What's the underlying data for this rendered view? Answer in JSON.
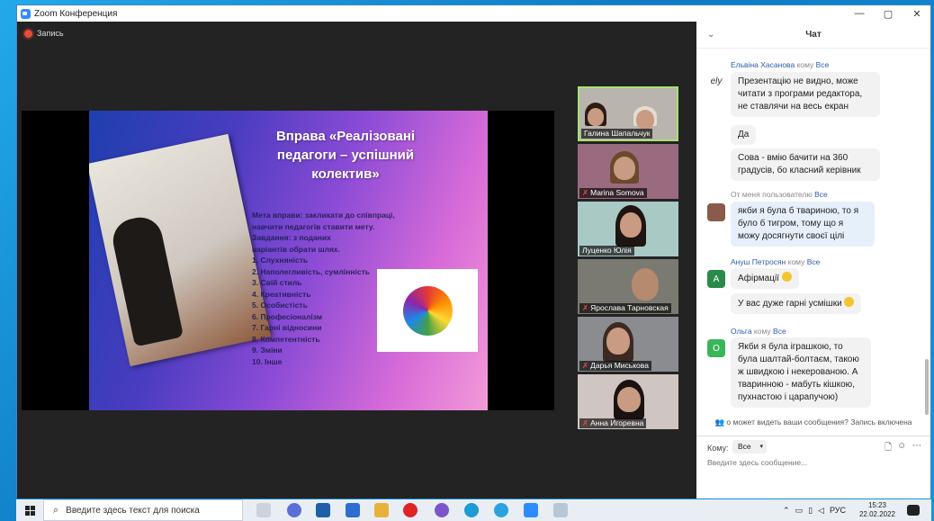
{
  "window": {
    "title": "Zoom Конференция"
  },
  "meeting": {
    "recording_label": "Запись"
  },
  "slide": {
    "title_lines": [
      "Вправа «Реалізовані",
      "педагоги – успішний",
      "колектив»"
    ],
    "body_lines": [
      "Мета вправи: закликати до співпраці,",
      "навчити педагогів ставити мету.",
      "Завдання: з поданих",
      "варіантів обрати шлях.",
      "1. Слухняність",
      "2. Наполегливість, сумлінність",
      "3. Свій стиль",
      "4. Креативність",
      "5. Особистість",
      "6. Професіоналізм",
      "7. Гарні відносини",
      "8. Компетентність",
      "9. Зміни",
      "10. Інше"
    ]
  },
  "participants": [
    {
      "name": "Галина Шапальчук",
      "muted": false,
      "active": true
    },
    {
      "name": "Marina Somova",
      "muted": true,
      "active": false
    },
    {
      "name": "Луценко Юлія",
      "muted": true,
      "active": false
    },
    {
      "name": "Ярослава Тарновская",
      "muted": true,
      "active": false
    },
    {
      "name": "Дарья Миськова",
      "muted": true,
      "active": false
    },
    {
      "name": "Анна Игоревна",
      "muted": true,
      "active": false
    }
  ],
  "chat": {
    "header_title": "Чат",
    "messages": [
      {
        "sender": "Ельвіна Хасанова",
        "to_word": "кому",
        "to": "Все",
        "avatar": "ely",
        "texts": [
          "Презентацію не видно, може читати з програми редактора, не ставлячи на весь екран",
          "Да",
          "Сова - вмію бачити на 360 градусів, бо класний керівник"
        ]
      },
      {
        "sender": "От меня пользователю",
        "to": "Все",
        "avatar": "photo",
        "texts": [
          "якби я була б твариною, то я було б тигром, тому що я можу досягнути своєї цілі"
        ]
      },
      {
        "sender": "Ануш Петросян",
        "to_word": "кому",
        "to": "Все",
        "avatar": "A",
        "texts": [
          "Афірмації",
          "У вас дуже гарні усмішки"
        ]
      },
      {
        "sender": "Ольга",
        "to_word": "кому",
        "to": "Все",
        "avatar": "O",
        "texts": [
          "Якби я була іграшкою, то була шалтай-болтаєм, такою ж швидкою і некерованою. А тваринною - мабуть кішкою, пухнастою і царапучою)"
        ]
      }
    ],
    "notice": "о может видеть ваши сообщения? Запись включена",
    "to_label": "Кому:",
    "to_value": "Все",
    "input_placeholder": "Введите здесь сообщение..."
  },
  "taskbar": {
    "search_placeholder": "Введите здесь текст для поиска",
    "language": "РУС",
    "time": "15:23",
    "date": "22.02.2022"
  },
  "colors": {
    "zoom_blue": "#2d8cff",
    "active_speaker": "#a7e26e",
    "record_red": "#e84a3c",
    "sender_blue": "#2d5fa8"
  }
}
